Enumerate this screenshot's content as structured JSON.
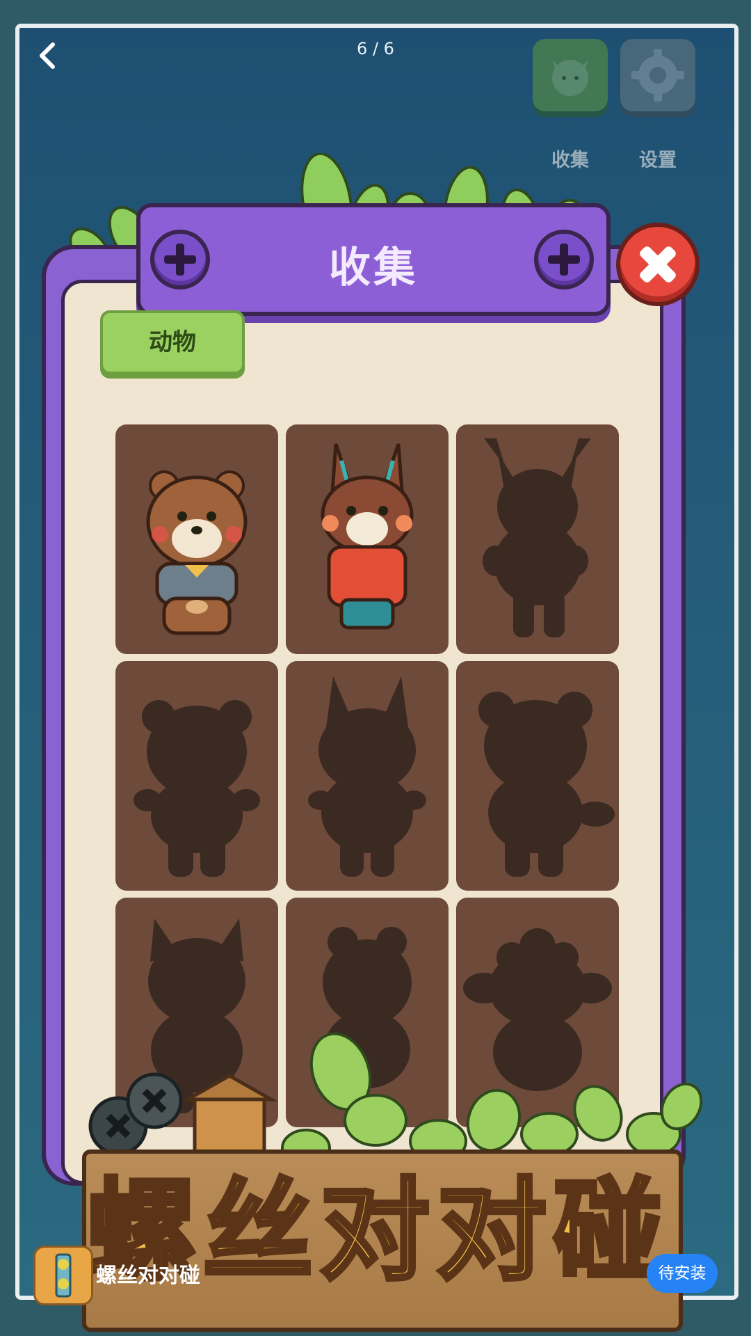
{
  "header": {
    "back_icon": "chevron-left-icon",
    "page_counter": "6 / 6",
    "collect_label": "收集",
    "settings_label": "设置"
  },
  "panel": {
    "title": "收集",
    "active_tab": "动物",
    "cards": [
      {
        "state": "unlocked",
        "animal": "bear"
      },
      {
        "state": "unlocked",
        "animal": "fox"
      },
      {
        "state": "locked",
        "animal": "deer"
      },
      {
        "state": "locked",
        "animal": "bear-silhouette"
      },
      {
        "state": "locked",
        "animal": "fox-silhouette"
      },
      {
        "state": "locked",
        "animal": "bear-silhouette-2"
      },
      {
        "state": "locked",
        "animal": "cat-silhouette"
      },
      {
        "state": "locked",
        "animal": "bear-silhouette-3"
      },
      {
        "state": "locked",
        "animal": "sheep-silhouette"
      }
    ]
  },
  "footer": {
    "game_title": "螺丝对对碰",
    "app_name": "螺丝对对碰",
    "install_button": "待安装"
  },
  "colors": {
    "panel_purple": "#8d5fd6",
    "card_brown": "#6e4a3a",
    "tab_green": "#9bd160",
    "close_red": "#e8473e",
    "install_blue": "#2583f6"
  }
}
